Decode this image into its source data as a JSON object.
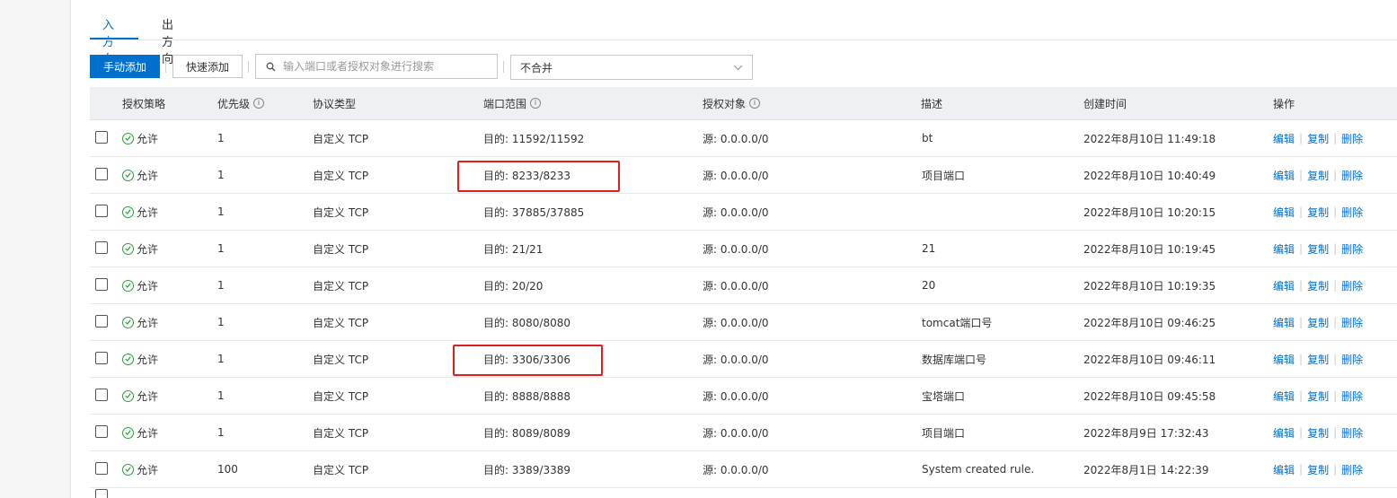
{
  "tabs": [
    {
      "label": "入方向",
      "active": true
    },
    {
      "label": "出方向",
      "active": false
    }
  ],
  "toolbar": {
    "manual_add_label": "手动添加",
    "quick_add_label": "快速添加",
    "search_placeholder": "输入端口或者授权对象进行搜索",
    "merge_select_value": "不合并"
  },
  "table": {
    "headers": {
      "policy": "授权策略",
      "priority": "优先级",
      "protocol": "协议类型",
      "port_range": "端口范围",
      "auth_object": "授权对象",
      "description": "描述",
      "created": "创建时间",
      "actions": "操作"
    },
    "action_labels": {
      "edit": "编辑",
      "copy": "复制",
      "delete": "删除"
    },
    "rows": [
      {
        "policy": "允许",
        "priority": "1",
        "protocol": "自定义 TCP",
        "port": "目的: 11592/11592",
        "auth": "源: 0.0.0.0/0",
        "desc": "bt",
        "created": "2022年8月10日 11:49:18",
        "highlight": false
      },
      {
        "policy": "允许",
        "priority": "1",
        "protocol": "自定义 TCP",
        "port": "目的: 8233/8233",
        "auth": "源: 0.0.0.0/0",
        "desc": "项目端口",
        "created": "2022年8月10日 10:40:49",
        "highlight": true
      },
      {
        "policy": "允许",
        "priority": "1",
        "protocol": "自定义 TCP",
        "port": "目的: 37885/37885",
        "auth": "源: 0.0.0.0/0",
        "desc": "",
        "created": "2022年8月10日 10:20:15",
        "highlight": false
      },
      {
        "policy": "允许",
        "priority": "1",
        "protocol": "自定义 TCP",
        "port": "目的: 21/21",
        "auth": "源: 0.0.0.0/0",
        "desc": "21",
        "created": "2022年8月10日 10:19:45",
        "highlight": false
      },
      {
        "policy": "允许",
        "priority": "1",
        "protocol": "自定义 TCP",
        "port": "目的: 20/20",
        "auth": "源: 0.0.0.0/0",
        "desc": "20",
        "created": "2022年8月10日 10:19:35",
        "highlight": false
      },
      {
        "policy": "允许",
        "priority": "1",
        "protocol": "自定义 TCP",
        "port": "目的: 8080/8080",
        "auth": "源: 0.0.0.0/0",
        "desc": "tomcat端口号",
        "created": "2022年8月10日 09:46:25",
        "highlight": false
      },
      {
        "policy": "允许",
        "priority": "1",
        "protocol": "自定义 TCP",
        "port": "目的: 3306/3306",
        "auth": "源: 0.0.0.0/0",
        "desc": "数据库端口号",
        "created": "2022年8月10日 09:46:11",
        "highlight": true
      },
      {
        "policy": "允许",
        "priority": "1",
        "protocol": "自定义 TCP",
        "port": "目的: 8888/8888",
        "auth": "源: 0.0.0.0/0",
        "desc": "宝塔端口",
        "created": "2022年8月10日 09:45:58",
        "highlight": false
      },
      {
        "policy": "允许",
        "priority": "1",
        "protocol": "自定义 TCP",
        "port": "目的: 8089/8089",
        "auth": "源: 0.0.0.0/0",
        "desc": "项目端口",
        "created": "2022年8月9日 17:32:43",
        "highlight": false
      },
      {
        "policy": "允许",
        "priority": "100",
        "protocol": "自定义 TCP",
        "port": "目的: 3389/3389",
        "auth": "源: 0.0.0.0/0",
        "desc": "System created rule.",
        "created": "2022年8月1日 14:22:39",
        "highlight": false
      }
    ]
  },
  "colors": {
    "accent": "#0070cc",
    "highlight": "#e02020",
    "allow": "#2a9d3a"
  }
}
